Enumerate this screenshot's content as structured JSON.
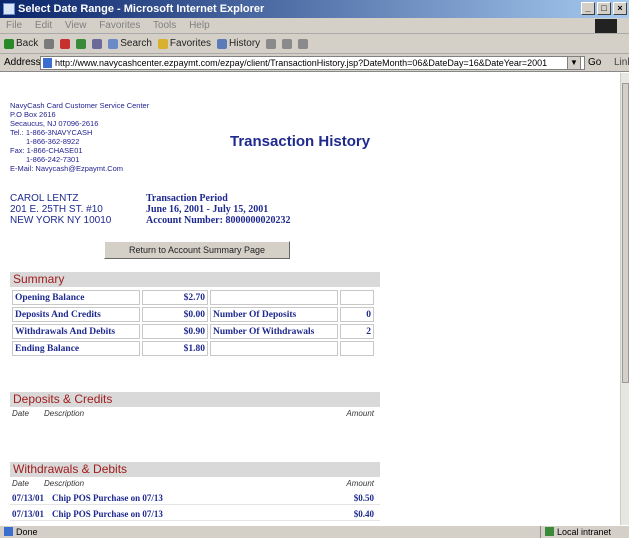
{
  "window": {
    "title": "Select Date Range - Microsoft Internet Explorer",
    "min_glyph": "_",
    "max_glyph": "□",
    "close_glyph": "×"
  },
  "menu": [
    "File",
    "Edit",
    "View",
    "Favorites",
    "Tools",
    "Help"
  ],
  "toolbar": {
    "back": "Back",
    "search": "Search",
    "favorites": "Favorites",
    "history": "History"
  },
  "address": {
    "label": "Address",
    "url": "http://www.navycashcenter.ezpaymt.com/ezpay/client/TransactionHistory.jsp?DateMonth=06&DateDay=16&DateYear=2001",
    "go": "Go",
    "links": "Links"
  },
  "center": {
    "lines": [
      "NavyCash Card Customer Service Center",
      "P.O Box 2616",
      "Secaucus, NJ 07096-2616",
      "Tel.: 1-866-3NAVYCASH",
      "1-866-362-8922",
      "Fax: 1-866-CHASE01",
      "1-866-242-7301",
      "E-Mail: Navycash@Ezpaymt.Com"
    ]
  },
  "page_title": "Transaction History",
  "customer": {
    "name": "CAROL LENTZ",
    "street": "201 E. 25TH ST. #10",
    "city": "NEW YORK NY 10010"
  },
  "period": {
    "label": "Transaction Period",
    "range": "June 16, 2001 - July 15, 2001",
    "account_label": "Account Number:",
    "account_number": "8000000020232"
  },
  "return_button": "Return to Account Summary Page",
  "summary": {
    "heading": "Summary",
    "rows": [
      {
        "label": "Opening Balance",
        "value": "$2.70",
        "label2": "",
        "value2": ""
      },
      {
        "label": "Deposits And Credits",
        "value": "$0.00",
        "label2": "Number Of Deposits",
        "value2": "0"
      },
      {
        "label": "Withdrawals And Debits",
        "value": "$0.90",
        "label2": "Number Of Withdrawals",
        "value2": "2"
      },
      {
        "label": "Ending Balance",
        "value": "$1.80",
        "label2": "",
        "value2": ""
      }
    ]
  },
  "deposits": {
    "heading": "Deposits & Credits",
    "columns": {
      "date": "Date",
      "description": "Description",
      "amount": "Amount"
    }
  },
  "withdrawals": {
    "heading": "Withdrawals & Debits",
    "columns": {
      "date": "Date",
      "description": "Description",
      "amount": "Amount"
    },
    "rows": [
      {
        "date": "07/13/01",
        "description": "Chip POS Purchase on 07/13",
        "amount": "$0.50"
      },
      {
        "date": "07/13/01",
        "description": "Chip POS Purchase on 07/13",
        "amount": "$0.40"
      }
    ]
  },
  "status": {
    "left": "Done",
    "zone": "Local intranet"
  }
}
